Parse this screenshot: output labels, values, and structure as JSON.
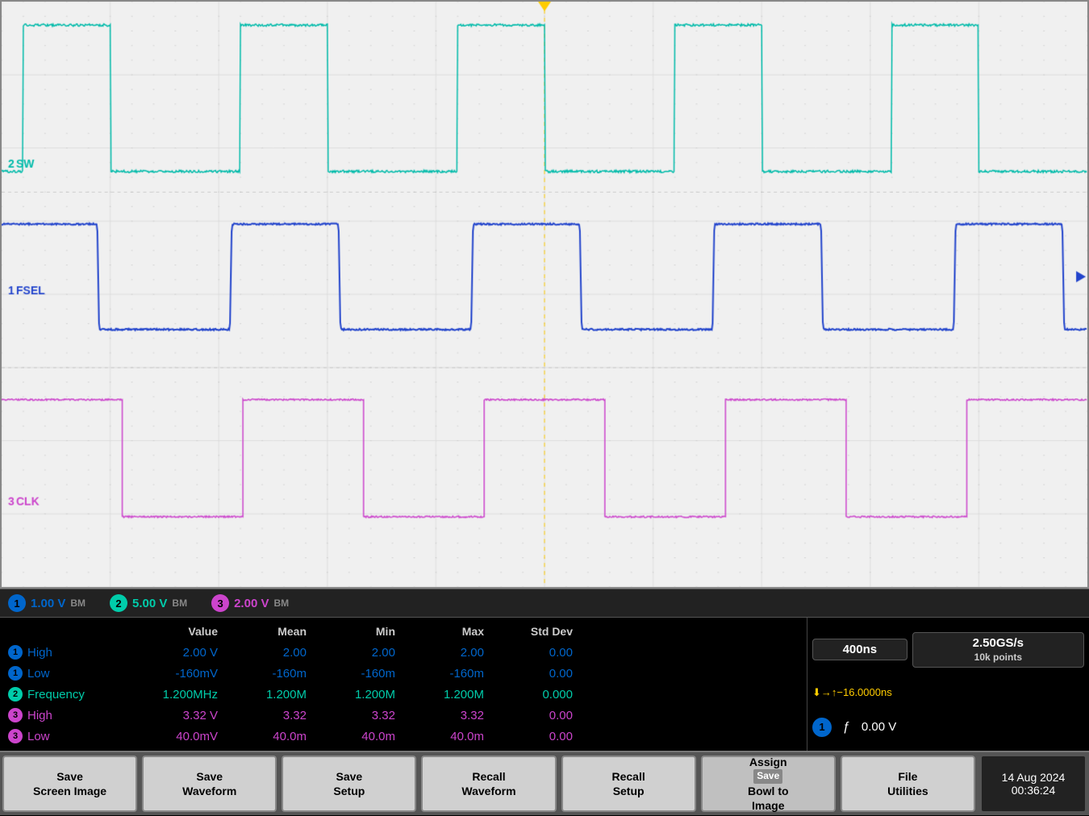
{
  "channels": [
    {
      "num": "1",
      "color": "#0066cc",
      "voltage": "1.00 V",
      "ground": "BM"
    },
    {
      "num": "2",
      "color": "#00ccaa",
      "voltage": "5.00 V",
      "ground": "BM"
    },
    {
      "num": "3",
      "color": "#cc44cc",
      "voltage": "2.00 V",
      "ground": "BM"
    }
  ],
  "stats": {
    "headers": [
      "",
      "Value",
      "Mean",
      "Min",
      "Max",
      "Std Dev"
    ],
    "rows": [
      {
        "circle": "1",
        "circle_color": "#0066cc",
        "label": "High",
        "label_color": "#0066cc",
        "value": "2.00 V",
        "mean": "2.00",
        "min": "2.00",
        "max": "2.00",
        "stddev": "0.00"
      },
      {
        "circle": "1",
        "circle_color": "#0066cc",
        "label": "Low",
        "label_color": "#0066cc",
        "value": "-160mV",
        "mean": "-160m",
        "min": "-160m",
        "max": "-160m",
        "stddev": "0.00"
      },
      {
        "circle": "2",
        "circle_color": "#00ccaa",
        "label": "Frequency",
        "label_color": "#00ccaa",
        "value": "1.200MHz",
        "mean": "1.200M",
        "min": "1.200M",
        "max": "1.200M",
        "stddev": "0.000"
      },
      {
        "circle": "3",
        "circle_color": "#cc44cc",
        "label": "High",
        "label_color": "#cc44cc",
        "value": "3.32 V",
        "mean": "3.32",
        "min": "3.32",
        "max": "3.32",
        "stddev": "0.00"
      },
      {
        "circle": "3",
        "circle_color": "#cc44cc",
        "label": "Low",
        "label_color": "#cc44cc",
        "value": "40.0mV",
        "mean": "40.0m",
        "min": "40.0m",
        "max": "40.0m",
        "stddev": "0.00"
      }
    ]
  },
  "timing": {
    "timebase": "400ns",
    "trigger_label": "⬇→↑−16.0000ns",
    "sample_rate": "2.50GS/s",
    "points": "10k points",
    "channel_num": "1",
    "channel_color": "#0066cc",
    "func": "ƒ",
    "voltage": "0.00 V"
  },
  "buttons": [
    {
      "id": "save-screen",
      "line1": "Save",
      "line2": "Screen Image"
    },
    {
      "id": "save-waveform",
      "line1": "Save",
      "line2": "Waveform"
    },
    {
      "id": "save-setup",
      "line1": "Save",
      "line2": "Setup"
    },
    {
      "id": "recall-waveform",
      "line1": "Recall",
      "line2": "Waveform"
    },
    {
      "id": "recall-setup",
      "line1": "Recall",
      "line2": "Setup"
    },
    {
      "id": "assign-bowl",
      "line1": "Assign",
      "line2": "Bowl to",
      "line3": "Image",
      "sub_label": "Save"
    },
    {
      "id": "file-utilities",
      "line1": "File",
      "line2": "Utilities"
    }
  ],
  "date": {
    "line1": "14 Aug 2024",
    "line2": "00:36:24"
  },
  "waveform_labels": {
    "ch1_label": "FSEL",
    "ch2_label": "SW",
    "ch3_label": "CLK",
    "ch1_num": "1",
    "ch2_num": "2",
    "ch3_num": "3"
  }
}
